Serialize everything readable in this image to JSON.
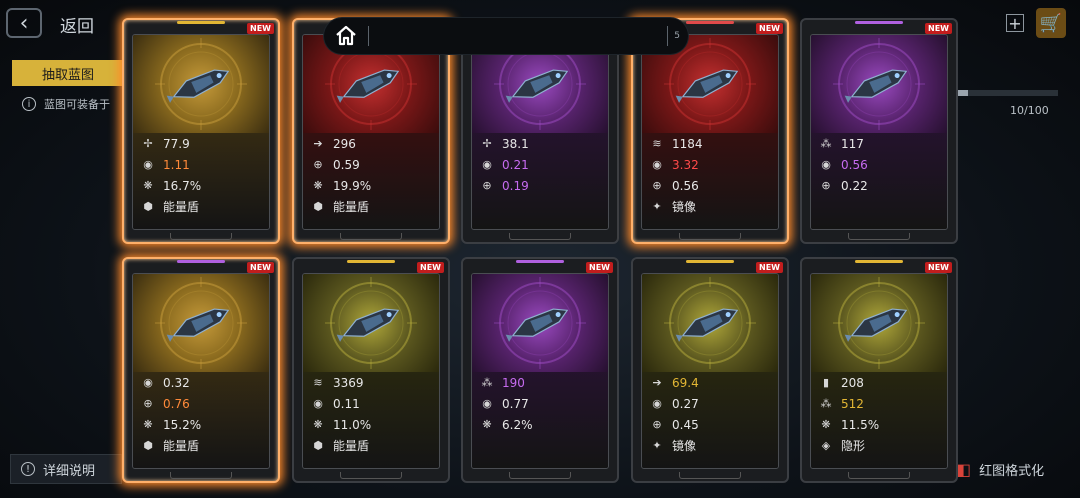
{
  "header": {
    "back_label": "返回"
  },
  "tabs": {
    "extract_label": "抽取蓝图"
  },
  "info": {
    "text": "蓝图可装备于"
  },
  "progress": {
    "text": "10/100",
    "fraction": 0.1
  },
  "footer": {
    "details_label": "详细说明",
    "red_format_label": "红图格式化"
  },
  "search": {
    "count": "5"
  },
  "colors": {
    "gold": "#d7b23a",
    "red": "#7a1a1a",
    "purple": "#4a1f5a",
    "olive": "#5a5622",
    "glow": "#ff8a2a"
  },
  "cards": [
    {
      "rarity": "gold",
      "theme": "gold",
      "glow": true,
      "badge": "NEW",
      "ship": "ship-pod-icon",
      "stats": [
        {
          "icon": "dps-icon",
          "value": "77.9",
          "color": "#e8e8e8"
        },
        {
          "icon": "rate-icon",
          "value": "1.11",
          "color": "#ff8a3a"
        },
        {
          "icon": "crit-icon",
          "value": "16.7%",
          "color": "#e8e8e8"
        },
        {
          "icon": "shield-icon",
          "value": "能量盾",
          "color": "#e8e8e8"
        }
      ]
    },
    {
      "rarity": "red",
      "theme": "red",
      "glow": true,
      "badge": "NEW",
      "ship": "ship-lance-icon",
      "stats": [
        {
          "icon": "speed-icon",
          "value": "296",
          "color": "#e8e8e8"
        },
        {
          "icon": "target-icon",
          "value": "0.59",
          "color": "#e8e8e8"
        },
        {
          "icon": "crit-icon",
          "value": "19.9%",
          "color": "#e8e8e8"
        },
        {
          "icon": "shield-icon",
          "value": "能量盾",
          "color": "#e8e8e8"
        }
      ]
    },
    {
      "rarity": "purple",
      "theme": "purple",
      "glow": false,
      "badge": "NEW",
      "ship": "ship-frigate-icon",
      "stats": [
        {
          "icon": "dps-icon",
          "value": "38.1",
          "color": "#e8e8e8"
        },
        {
          "icon": "rate-icon",
          "value": "0.21",
          "color": "#c66bf0"
        },
        {
          "icon": "target-icon",
          "value": "0.19",
          "color": "#c66bf0"
        }
      ]
    },
    {
      "rarity": "red",
      "theme": "red",
      "glow": true,
      "badge": "NEW",
      "ship": "ship-fighter-icon",
      "stats": [
        {
          "icon": "armor-icon",
          "value": "1184",
          "color": "#e8e8e8"
        },
        {
          "icon": "rate-icon",
          "value": "3.32",
          "color": "#ff4a4a"
        },
        {
          "icon": "target-icon",
          "value": "0.56",
          "color": "#e8e8e8"
        },
        {
          "icon": "mirror-icon",
          "value": "镜像",
          "color": "#e8e8e8"
        }
      ]
    },
    {
      "rarity": "purple",
      "theme": "purple",
      "glow": false,
      "badge": "NEW",
      "ship": "ship-blade-icon",
      "stats": [
        {
          "icon": "cluster-icon",
          "value": "117",
          "color": "#e8e8e8"
        },
        {
          "icon": "rate-icon",
          "value": "0.56",
          "color": "#c66bf0"
        },
        {
          "icon": "target-icon",
          "value": "0.22",
          "color": "#e8e8e8"
        }
      ]
    },
    {
      "rarity": "purple",
      "theme": "gold",
      "glow": true,
      "badge": "NEW",
      "ship": "ship-spider-icon",
      "stats": [
        {
          "icon": "rate-icon",
          "value": "0.32",
          "color": "#e8e8e8"
        },
        {
          "icon": "target-icon",
          "value": "0.76",
          "color": "#ff8a3a"
        },
        {
          "icon": "crit-icon",
          "value": "15.2%",
          "color": "#e8e8e8"
        },
        {
          "icon": "shield-icon",
          "value": "能量盾",
          "color": "#e8e8e8"
        }
      ]
    },
    {
      "rarity": "gold",
      "theme": "olive",
      "glow": false,
      "badge": "NEW",
      "ship": "ship-capsule-icon",
      "stats": [
        {
          "icon": "armor-icon",
          "value": "3369",
          "color": "#e8e8e8"
        },
        {
          "icon": "rate-icon",
          "value": "0.11",
          "color": "#e8e8e8"
        },
        {
          "icon": "crit-icon",
          "value": "11.0%",
          "color": "#e8e8e8"
        },
        {
          "icon": "shield-icon",
          "value": "能量盾",
          "color": "#e8e8e8"
        }
      ]
    },
    {
      "rarity": "purple",
      "theme": "purple",
      "glow": false,
      "badge": "NEW",
      "ship": "ship-cannon-icon",
      "stats": [
        {
          "icon": "cluster-icon",
          "value": "190",
          "color": "#c66bf0"
        },
        {
          "icon": "rate-icon",
          "value": "0.77",
          "color": "#e8e8e8"
        },
        {
          "icon": "crit-icon",
          "value": "6.2%",
          "color": "#e8e8e8"
        }
      ]
    },
    {
      "rarity": "gold",
      "theme": "olive",
      "glow": false,
      "badge": "NEW",
      "ship": "ship-cruiser-icon",
      "stats": [
        {
          "icon": "speed-icon",
          "value": "69.4",
          "color": "#e2b634"
        },
        {
          "icon": "rate-icon",
          "value": "0.27",
          "color": "#e8e8e8"
        },
        {
          "icon": "target-icon",
          "value": "0.45",
          "color": "#e8e8e8"
        },
        {
          "icon": "mirror-icon",
          "value": "镜像",
          "color": "#e8e8e8"
        }
      ]
    },
    {
      "rarity": "gold",
      "theme": "olive",
      "glow": false,
      "badge": "NEW",
      "ship": "ship-dart-icon",
      "stats": [
        {
          "icon": "barrage-icon",
          "value": "208",
          "color": "#e8e8e8"
        },
        {
          "icon": "cluster-icon",
          "value": "512",
          "color": "#e2b634"
        },
        {
          "icon": "crit-icon",
          "value": "11.5%",
          "color": "#e8e8e8"
        },
        {
          "icon": "stealth-icon",
          "value": "隐形",
          "color": "#e8e8e8"
        }
      ]
    }
  ]
}
